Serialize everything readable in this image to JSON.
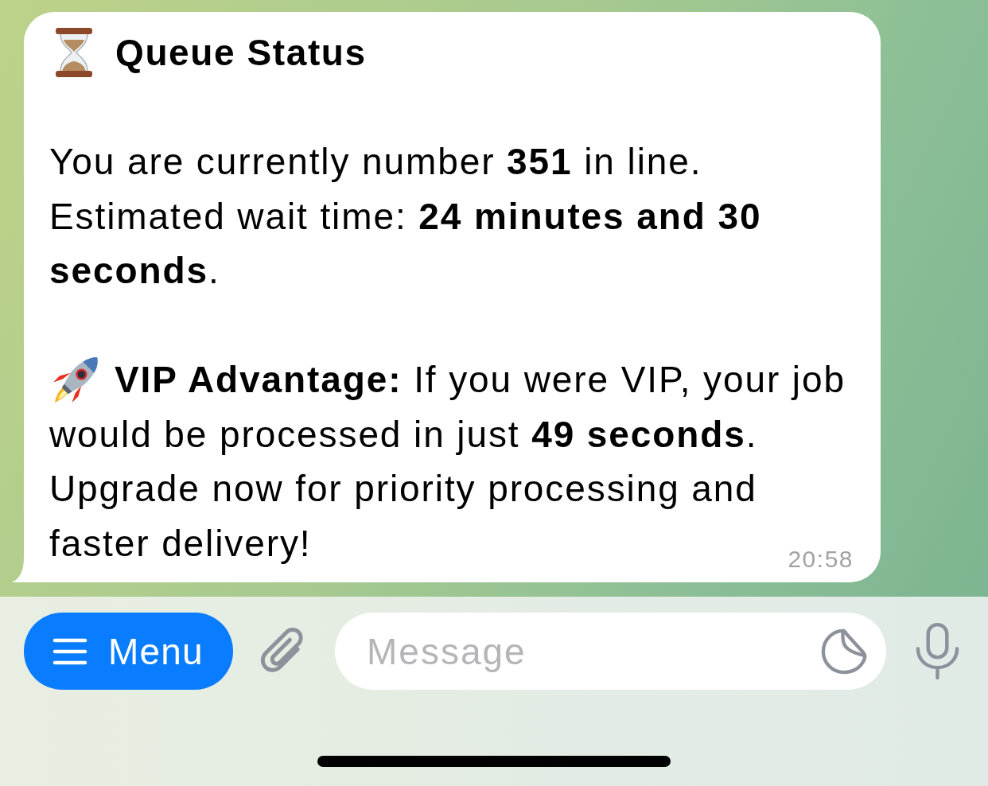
{
  "message": {
    "title": "Queue Status",
    "blocks": [
      {
        "kind": "info",
        "lines": [
          "You are currently number **351** in line.",
          "Estimated wait time: **24 minutes and 30 seconds**."
        ]
      },
      {
        "kind": "promo",
        "lines": [
          "**VIP Advantage:** If you were VIP, your job",
          "would be processed in just **49 seconds**.",
          "Upgrade now for priority processing and",
          "faster delivery!"
        ]
      }
    ],
    "time": "20:58"
  },
  "composer": {
    "menu_label": "Menu",
    "placeholder": "Message"
  }
}
